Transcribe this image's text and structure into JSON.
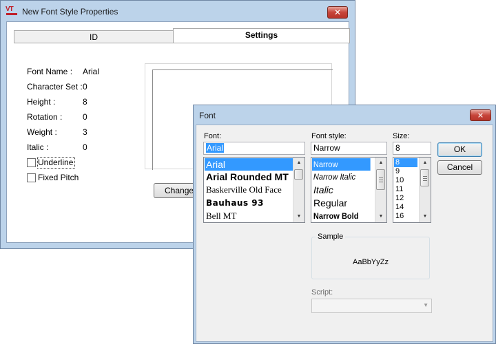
{
  "props_window": {
    "title": "New Font Style Properties",
    "icon": "vt-app-icon",
    "icon_text": "VT",
    "close_glyph": "✕",
    "tabs": [
      {
        "label": "ID"
      },
      {
        "label": "Settings"
      }
    ],
    "fields": [
      {
        "label": "Font Name :",
        "value": "Arial"
      },
      {
        "label": "Character Set :",
        "value": "0"
      },
      {
        "label": "Height :",
        "value": "8"
      },
      {
        "label": "Rotation :",
        "value": "0"
      },
      {
        "label": "Weight :",
        "value": "3"
      },
      {
        "label": "Italic :",
        "value": "0"
      }
    ],
    "checkboxes": [
      {
        "label": "Underline",
        "checked": false
      },
      {
        "label": "Fixed Pitch",
        "checked": false
      }
    ],
    "change_button": "Change"
  },
  "font_dialog": {
    "title": "Font",
    "close_glyph": "✕",
    "font_label": "Font:",
    "font_value": "Arial",
    "font_list": [
      "Arial",
      "Arial Rounded MT",
      "Baskerville Old Face",
      "Bauhaus 93",
      "Bell MT"
    ],
    "style_label": "Font style:",
    "style_value": "Narrow",
    "style_list": [
      "Narrow",
      "Narrow Italic",
      "Italic",
      "Regular",
      "Narrow Bold"
    ],
    "size_label": "Size:",
    "size_value": "8",
    "size_list": [
      "8",
      "9",
      "10",
      "11",
      "12",
      "14",
      "16"
    ],
    "ok": "OK",
    "cancel": "Cancel",
    "sample_label": "Sample",
    "sample_text": "AaBbYyZz",
    "script_label": "Script:",
    "script_value": ""
  },
  "colors": {
    "selection": "#3399ff",
    "title_bar": "#bcd3ea",
    "close_button": "#c7453a"
  }
}
